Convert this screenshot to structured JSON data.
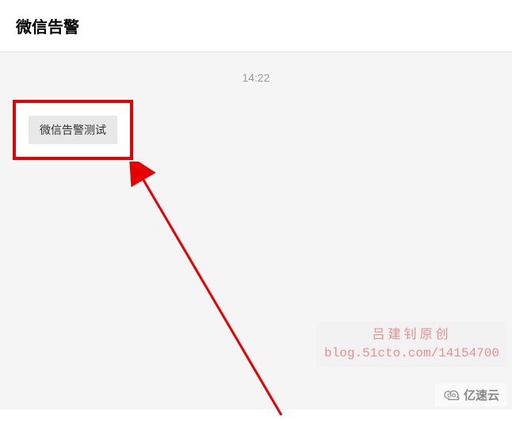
{
  "header": {
    "title": "微信告警"
  },
  "chat": {
    "timestamp": "14:22",
    "message": "微信告警测试"
  },
  "watermark": {
    "line1": "吕建钊原创",
    "line2": "blog.51cto.com/14154700"
  },
  "brand": {
    "label": "亿速云"
  },
  "colors": {
    "highlight_border": "#e60000",
    "chat_bg": "#f5f5f5"
  }
}
